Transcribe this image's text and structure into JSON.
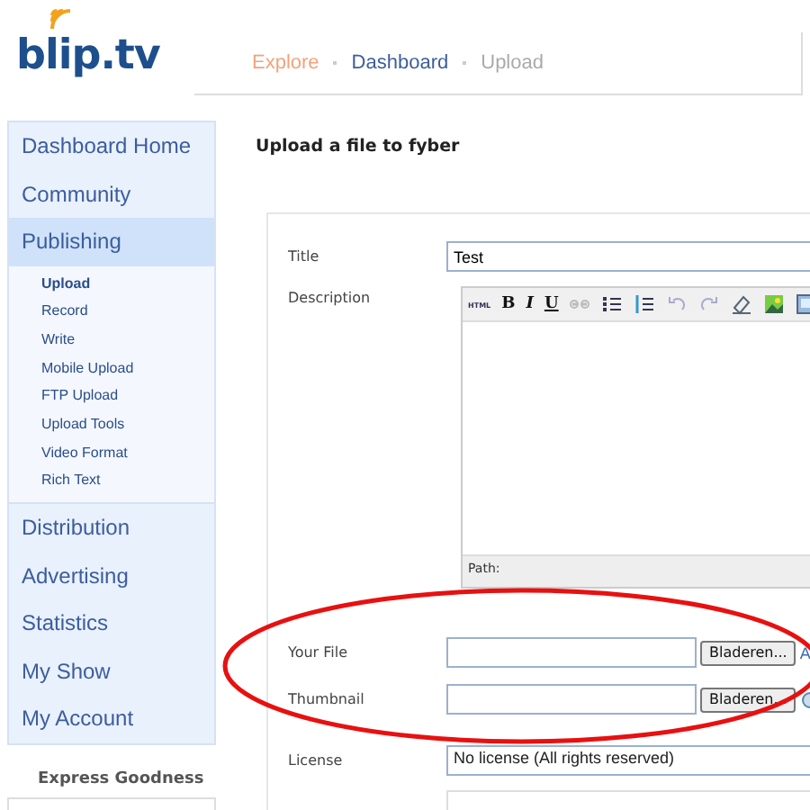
{
  "logo": {
    "text": "blip.tv"
  },
  "breadcrumb": [
    {
      "label": "Explore",
      "kind": "link"
    },
    {
      "label": "Dashboard",
      "kind": "link"
    },
    {
      "label": "Upload",
      "kind": "current"
    }
  ],
  "sidebar": {
    "items": [
      {
        "label": "Dashboard Home",
        "selected": false
      },
      {
        "label": "Community",
        "selected": false
      },
      {
        "label": "Publishing",
        "selected": true,
        "children": [
          {
            "label": "Upload",
            "selected": true
          },
          {
            "label": "Record",
            "selected": false
          },
          {
            "label": "Write",
            "selected": false
          },
          {
            "label": "Mobile Upload",
            "selected": false
          },
          {
            "label": "FTP Upload",
            "selected": false
          },
          {
            "label": "Upload Tools",
            "selected": false
          },
          {
            "label": "Video Format",
            "selected": false
          },
          {
            "label": "Rich Text",
            "selected": false
          }
        ]
      },
      {
        "label": "Distribution",
        "selected": false
      },
      {
        "label": "Advertising",
        "selected": false
      },
      {
        "label": "Statistics",
        "selected": false
      },
      {
        "label": "My Show",
        "selected": false
      },
      {
        "label": "My Account",
        "selected": false
      }
    ],
    "section_heading": "Express Goodness"
  },
  "page_title": "Upload a file to fyber",
  "form": {
    "title": {
      "label": "Title",
      "value": "Test"
    },
    "description": {
      "label": "Description",
      "toolbar": [
        {
          "kind": "html",
          "label": "HTML"
        },
        {
          "kind": "bold",
          "label": "B"
        },
        {
          "kind": "italic",
          "label": "I"
        },
        {
          "kind": "underline",
          "label": "U"
        },
        {
          "kind": "link"
        },
        {
          "kind": "bullets"
        },
        {
          "kind": "numbers"
        },
        {
          "kind": "undo"
        },
        {
          "kind": "redo"
        },
        {
          "kind": "eraser"
        },
        {
          "kind": "image"
        },
        {
          "kind": "media"
        }
      ],
      "path_label": "Path:"
    },
    "your_file": {
      "label": "Your File",
      "button": "Bladeren...",
      "link": "A"
    },
    "thumbnail": {
      "label": "Thumbnail",
      "button": "Bladeren..."
    },
    "license": {
      "label": "License",
      "value": "No license (All rights reserved)"
    }
  },
  "annotation": {
    "kind": "ellipse"
  }
}
